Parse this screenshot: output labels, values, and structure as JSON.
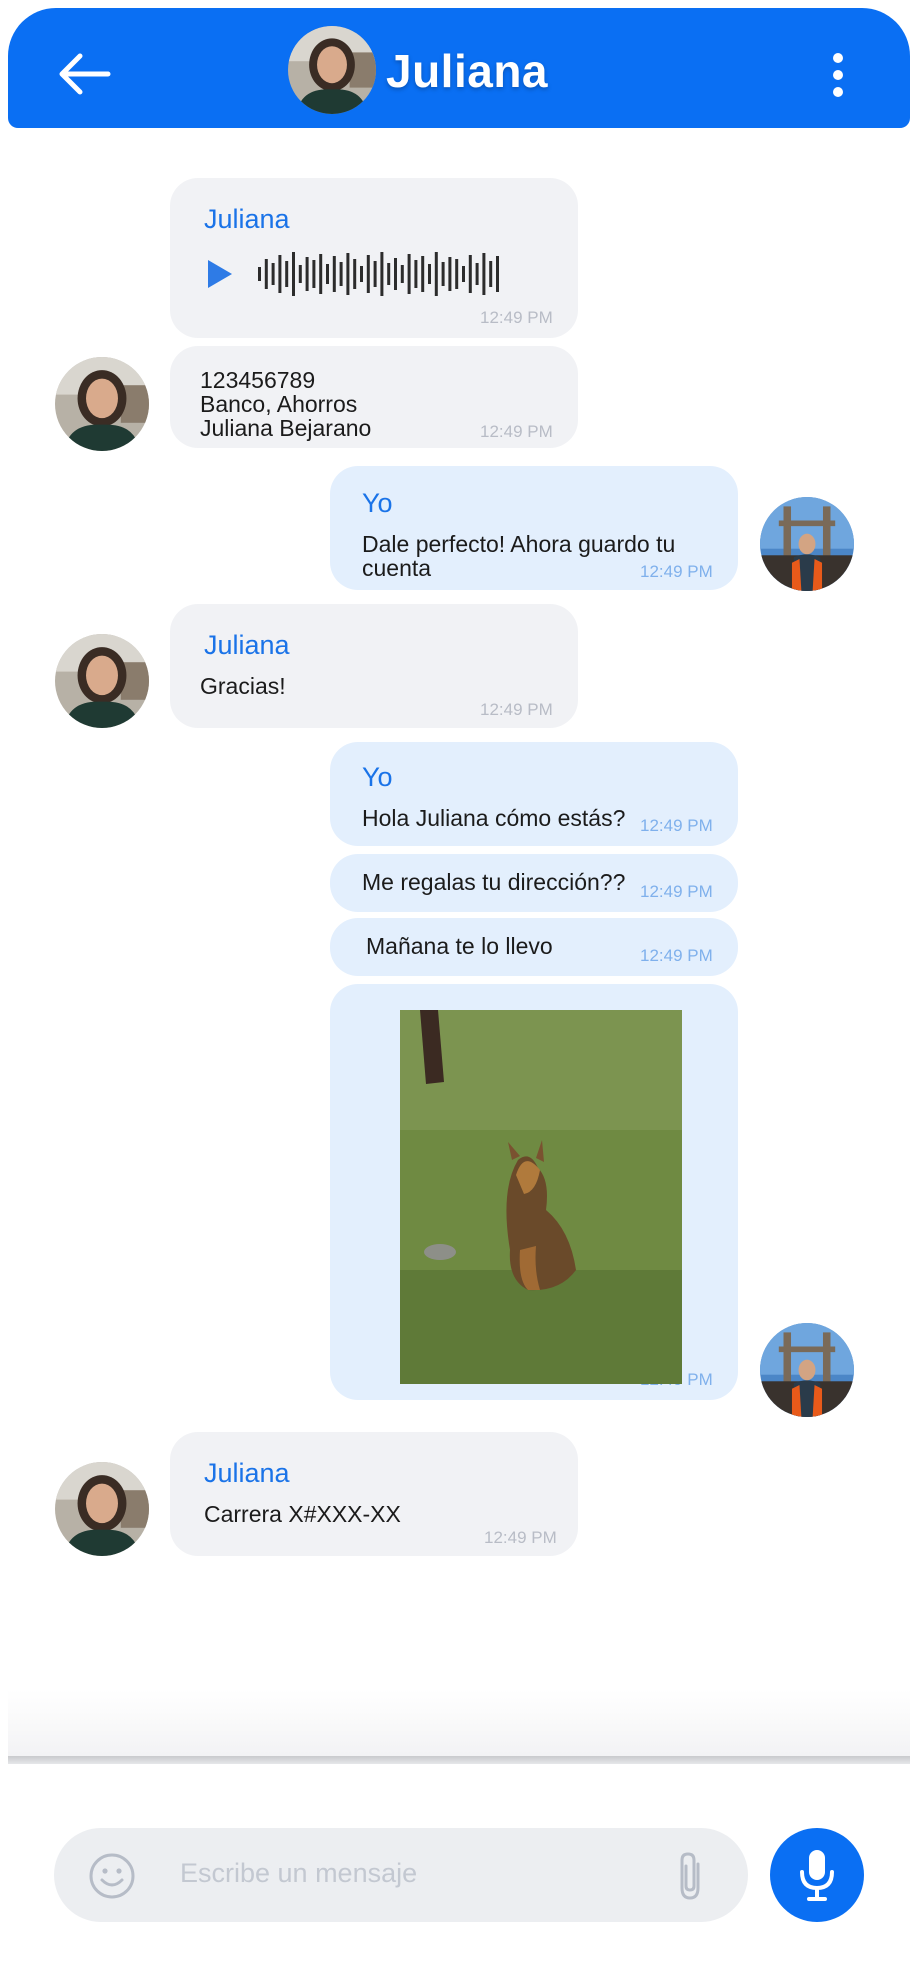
{
  "header": {
    "title": "Juliana"
  },
  "messages": [
    {
      "sender": "Juliana",
      "time": "12:49 PM",
      "type": "audio"
    },
    {
      "lines": [
        "123456789",
        "Banco, Ahorros",
        "Juliana Bejarano"
      ],
      "time": "12:49 PM"
    },
    {
      "sender": "Yo",
      "lines": [
        "Dale perfecto! Ahora guardo tu",
        "cuenta"
      ],
      "time": "12:49 PM"
    },
    {
      "sender": "Juliana",
      "text": "Gracias!",
      "time": "12:49 PM"
    },
    {
      "sender": "Yo",
      "text": "Hola Juliana cómo estás?",
      "time": "12:49 PM"
    },
    {
      "text": "Me regalas tu dirección??",
      "time": "12:49 PM"
    },
    {
      "text": "Mañana te lo llevo",
      "time": "12:49 PM"
    },
    {
      "type": "image",
      "time": "12:49 PM"
    },
    {
      "sender": "Juliana",
      "text": "Carrera X#XXX-XX",
      "time": "12:49 PM"
    }
  ],
  "composer": {
    "placeholder": "Escribe un mensaje"
  },
  "colors": {
    "accent": "#0a6ff3",
    "incoming": "#f1f2f5",
    "outgoing": "#e3effd"
  },
  "icons": [
    "back-arrow-icon",
    "more-vertical-icon",
    "play-icon",
    "waveform-icon",
    "emoji-icon",
    "paperclip-icon",
    "microphone-icon"
  ]
}
